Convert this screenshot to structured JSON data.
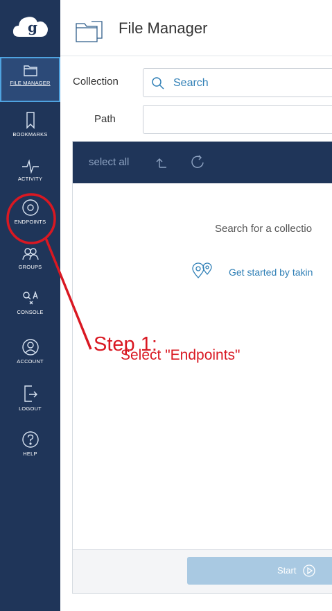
{
  "app": {
    "logo_letter": "g"
  },
  "header": {
    "title": "File Manager"
  },
  "sidebar": {
    "items": [
      {
        "label": "FILE MANAGER",
        "icon": "folder-icon",
        "active": true
      },
      {
        "label": "BOOKMARKS",
        "icon": "bookmark-icon"
      },
      {
        "label": "ACTIVITY",
        "icon": "activity-pulse-icon"
      },
      {
        "label": "ENDPOINTS",
        "icon": "endpoint-disc-icon"
      },
      {
        "label": "GROUPS",
        "icon": "groups-icon"
      },
      {
        "label": "CONSOLE",
        "icon": "console-icon"
      },
      {
        "label": "ACCOUNT",
        "icon": "account-icon"
      },
      {
        "label": "LOGOUT",
        "icon": "logout-icon"
      },
      {
        "label": "HELP",
        "icon": "help-icon"
      }
    ]
  },
  "collection": {
    "label": "Collection",
    "placeholder": "Search"
  },
  "path": {
    "label": "Path",
    "value": ""
  },
  "panel": {
    "select_all": "select all",
    "empty_message": "Search for a collectio",
    "get_started": "Get started by takin"
  },
  "footer": {
    "start_label": "Start"
  },
  "annotation": {
    "step": "Step 1:",
    "instruction": "Select \"Endpoints\"",
    "color": "#d91822"
  },
  "colors": {
    "sidebar": "#1f3559",
    "accent": "#4fa3e0",
    "link": "#2f7fb6",
    "start_button": "#a9c9e2"
  }
}
